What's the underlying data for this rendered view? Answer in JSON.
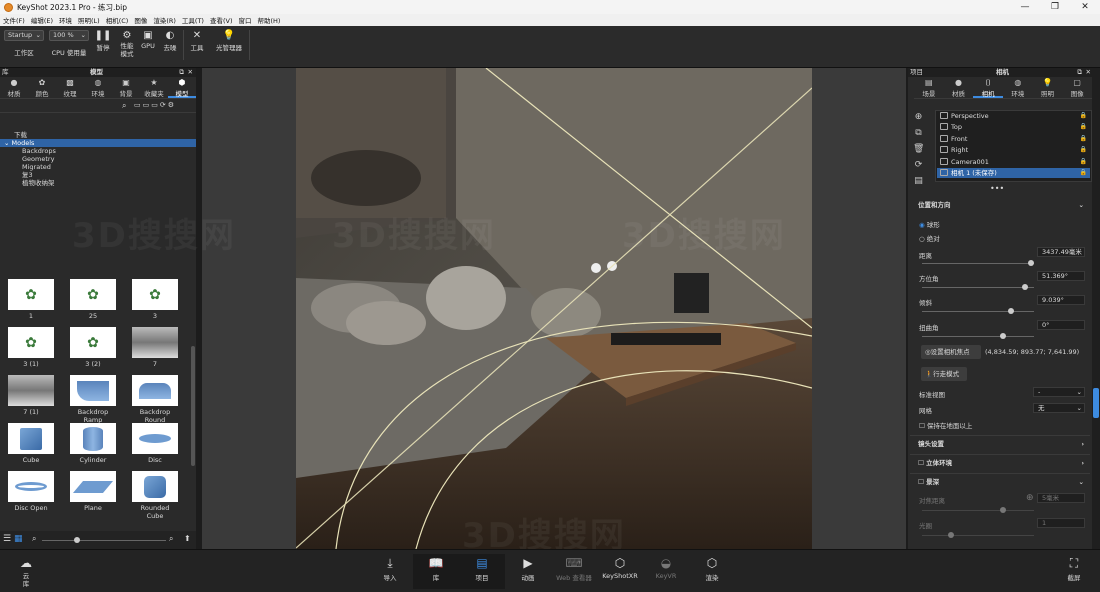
{
  "window": {
    "title": "KeyShot 2023.1 Pro - 练习.bip",
    "controls": [
      "—",
      "❐",
      "✕"
    ]
  },
  "menu": [
    "文件(F)",
    "编辑(E)",
    "环境",
    "照明(L)",
    "相机(C)",
    "图像",
    "渲染(R)",
    "工具(T)",
    "查看(V)",
    "窗口",
    "帮助(H)"
  ],
  "toolbar": {
    "workspace_value": "Startup",
    "workspace_label": "工作区",
    "cpu_value": "100 %",
    "cpu_label": "CPU 使用量",
    "pause_label": "暂停",
    "perf_label": "性能\n模式",
    "gpu_label": "GPU",
    "denoise_label": "去噪",
    "tools_label": "工具",
    "light_manager_label": "光管理器"
  },
  "library": {
    "title": "库",
    "panel_title": "模型",
    "tabs": [
      {
        "label": "材质",
        "icon": "material-icon"
      },
      {
        "label": "颜色",
        "icon": "color-icon"
      },
      {
        "label": "纹理",
        "icon": "texture-icon"
      },
      {
        "label": "环境",
        "icon": "environment-icon"
      },
      {
        "label": "背景",
        "icon": "background-icon"
      },
      {
        "label": "收藏夹",
        "icon": "favorite-icon"
      },
      {
        "label": "模型",
        "icon": "model-icon"
      }
    ],
    "tree": {
      "root": "下载",
      "models": "Models",
      "items": [
        "Backdrops",
        "Geometry",
        "Migrated",
        "复3",
        "植物收纳架"
      ]
    },
    "more": "•••",
    "thumbnails": [
      {
        "label": "1",
        "kind": "plant"
      },
      {
        "label": "25",
        "kind": "plant"
      },
      {
        "label": "3",
        "kind": "plant"
      },
      {
        "label": "3 (1)",
        "kind": "plant"
      },
      {
        "label": "3 (2)",
        "kind": "plant"
      },
      {
        "label": "7",
        "kind": "photo"
      },
      {
        "label": "7 (1)",
        "kind": "photo"
      },
      {
        "label": "Backdrop Ramp",
        "kind": "ramp"
      },
      {
        "label": "Backdrop Round",
        "kind": "round"
      },
      {
        "label": "Cube",
        "kind": "cube"
      },
      {
        "label": "Cylinder",
        "kind": "cyl"
      },
      {
        "label": "Disc",
        "kind": "disc"
      },
      {
        "label": "Disc Open",
        "kind": "discopen"
      },
      {
        "label": "Plane",
        "kind": "plane"
      },
      {
        "label": "Rounded Cube",
        "kind": "rcube"
      }
    ]
  },
  "watermark": "3D搜搜网",
  "right_panel": {
    "title": "项目",
    "panel_title": "相机",
    "tabs": [
      {
        "label": "场景",
        "icon": "scene-icon"
      },
      {
        "label": "材质",
        "icon": "material-icon"
      },
      {
        "label": "相机",
        "icon": "camera-icon"
      },
      {
        "label": "环境",
        "icon": "environment-icon"
      },
      {
        "label": "照明",
        "icon": "lighting-icon"
      },
      {
        "label": "图像",
        "icon": "image-icon"
      }
    ],
    "cameras": [
      "Perspective",
      "Top",
      "Front",
      "Right",
      "Camera001",
      "相机 1 (未保存)"
    ],
    "more": "•••",
    "position_section": "位置和方向",
    "mode_orbit": "球形",
    "mode_absolute": "绝对",
    "distance_label": "距离",
    "distance_value": "3437.49毫米",
    "azimuth_label": "方位角",
    "azimuth_value": "51.369°",
    "tilt_label": "倾斜",
    "tilt_value": "9.039°",
    "twist_label": "扭曲角",
    "twist_value": "0°",
    "set_focus_button": "设置相机焦点",
    "focus_coords": "(4,834.59; 893.77; 7,641.99)",
    "walk_mode_button": "行走模式",
    "standard_view_label": "标准视图",
    "standard_view_value": "-",
    "grid_label": "网格",
    "grid_value": "无",
    "keep_above_ground": "保持在地面以上",
    "lens_section": "镜头设置",
    "stereo_section": "立体环境",
    "dof_section": "景深",
    "focus_distance_label": "对焦距离",
    "focus_distance_value": "5毫米",
    "aperture_label": "光圈",
    "aperture_value": "1"
  },
  "bottombar": {
    "cloud_label": "云\n库",
    "items": [
      {
        "label": "导入",
        "icon": "import-icon",
        "state": "normal"
      },
      {
        "label": "库",
        "icon": "library-icon",
        "state": "active"
      },
      {
        "label": "项目",
        "icon": "project-icon",
        "state": "active"
      },
      {
        "label": "动画",
        "icon": "animation-icon",
        "state": "normal"
      },
      {
        "label": "Web 查看器",
        "icon": "web-viewer-icon",
        "state": "disabled"
      },
      {
        "label": "KeyShotXR",
        "icon": "keyshotxr-icon",
        "state": "normal"
      },
      {
        "label": "KeyVR",
        "icon": "keyvr-icon",
        "state": "disabled"
      },
      {
        "label": "渲染",
        "icon": "render-icon",
        "state": "normal"
      }
    ],
    "screenshot_label": "截屏"
  }
}
